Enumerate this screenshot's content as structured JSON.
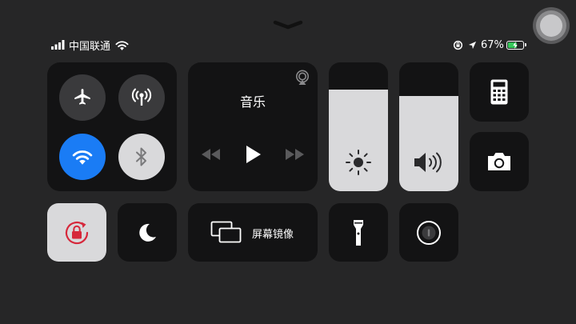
{
  "status_bar": {
    "carrier": "中国联通",
    "battery_percent": "67%",
    "signal_bars": 4,
    "battery_level": 0.67,
    "icons": [
      "signal-bars-icon",
      "wifi-icon",
      "orientation-lock-icon",
      "location-arrow-icon",
      "battery-charging-icon"
    ]
  },
  "music": {
    "title": "音乐",
    "controls": [
      "previous-icon",
      "play-icon",
      "next-icon"
    ],
    "airplay_icon": "airplay-icon"
  },
  "connectivity": {
    "airplane_mode": false,
    "cellular_data": false,
    "wifi": true,
    "bluetooth": true
  },
  "brightness": {
    "level": 0.79,
    "icon": "sun-icon"
  },
  "volume": {
    "level": 0.74,
    "icon": "speaker-icon"
  },
  "screen_mirroring": {
    "label": "屏幕镜像",
    "icon": "screen-mirroring-icon"
  },
  "toggles": {
    "orientation_lock": true,
    "do_not_disturb": false
  },
  "shortcuts": [
    "calculator-icon",
    "camera-icon",
    "flashlight-icon",
    "screen-recording-icon"
  ],
  "colors": {
    "background": "#262627",
    "tile": "#131314",
    "active_blue": "#1a7cf5",
    "active_light": "#d9d9db",
    "lock_red": "#d6283b",
    "battery_green": "#35c759"
  }
}
